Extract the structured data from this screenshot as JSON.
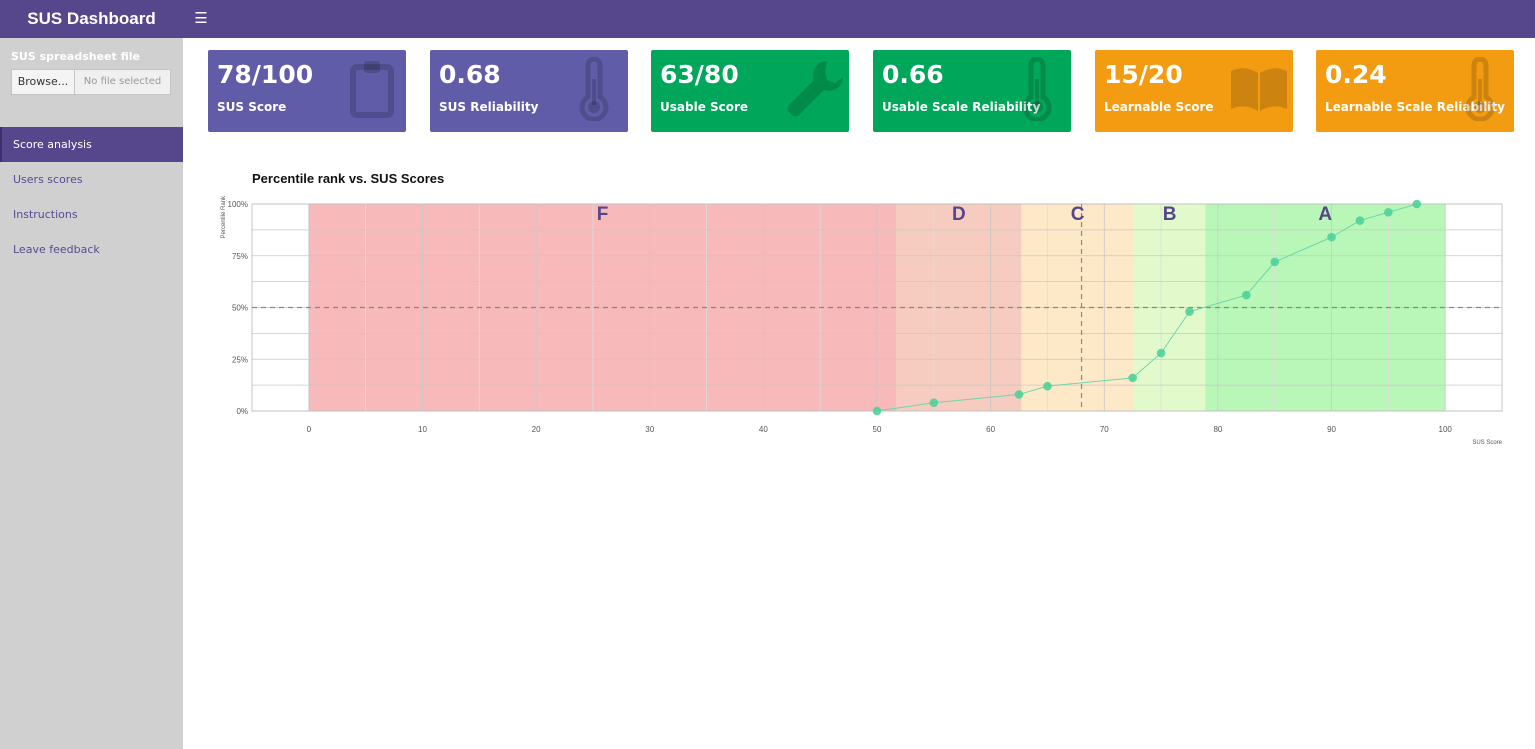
{
  "header": {
    "title": "SUS Dashboard",
    "menu_icon": "hamburger-icon"
  },
  "sidebar": {
    "upload_label": "SUS spreadsheet file",
    "browse_label": "Browse...",
    "file_placeholder": "No file selected",
    "items": [
      {
        "label": "Score analysis",
        "active": true
      },
      {
        "label": "Users scores",
        "active": false
      },
      {
        "label": "Instructions",
        "active": false
      },
      {
        "label": "Leave feedback",
        "active": false
      }
    ]
  },
  "cards": [
    {
      "value": "78/100",
      "label": "SUS Score",
      "icon": "clipboard-icon",
      "color": "#605ca8"
    },
    {
      "value": "0.68",
      "label": "SUS Reliability",
      "icon": "thermometer-icon",
      "color": "#605ca8"
    },
    {
      "value": "63/80",
      "label": "Usable Score",
      "icon": "wrench-icon",
      "color": "#00a65a"
    },
    {
      "value": "0.66",
      "label": "Usable Scale Reliability",
      "icon": "thermometer-icon",
      "color": "#00a65a"
    },
    {
      "value": "15/20",
      "label": "Learnable Score",
      "icon": "book-icon",
      "color": "#f39c12"
    },
    {
      "value": "0.24",
      "label": "Learnable Scale Reliability",
      "icon": "thermometer-icon",
      "color": "#f39c12"
    }
  ],
  "chart_data": {
    "type": "line",
    "title": "Percentile rank vs. SUS Scores",
    "xlabel": "SUS Score",
    "ylabel": "Percentile Rank",
    "xlim": [
      -5,
      105
    ],
    "ylim": [
      0,
      1
    ],
    "x_ticks": [
      0,
      10,
      20,
      30,
      40,
      50,
      60,
      70,
      80,
      90,
      100
    ],
    "y_ticks": [
      0,
      0.25,
      0.5,
      0.75,
      1
    ],
    "y_tick_labels": [
      "0%",
      "25%",
      "50%",
      "75%",
      "100%"
    ],
    "grade_bands": [
      {
        "grade": "F",
        "from": 0,
        "to": 51.7,
        "color": "#f08080"
      },
      {
        "grade": "D",
        "from": 51.7,
        "to": 62.7,
        "color": "#eda28a"
      },
      {
        "grade": "C",
        "from": 62.7,
        "to": 72.6,
        "color": "#fbd79a"
      },
      {
        "grade": "B",
        "from": 72.6,
        "to": 78.9,
        "color": "#caf6a0"
      },
      {
        "grade": "A",
        "from": 78.9,
        "to": 100,
        "color": "#80f080"
      }
    ],
    "reference_lines": {
      "x": 68,
      "y": 0.5
    },
    "series": [
      {
        "x": [
          50,
          55,
          62.5,
          65,
          72.5,
          75,
          77.5,
          82.5,
          85,
          90,
          92.5,
          95,
          97.5
        ],
        "y": [
          0,
          0.04,
          0.08,
          0.12,
          0.16,
          0.28,
          0.48,
          0.56,
          0.72,
          0.84,
          0.92,
          0.96,
          1.0
        ]
      }
    ],
    "colors": {
      "line": "#6dd6a8",
      "point": "#4fd19a"
    },
    "grid": true
  }
}
